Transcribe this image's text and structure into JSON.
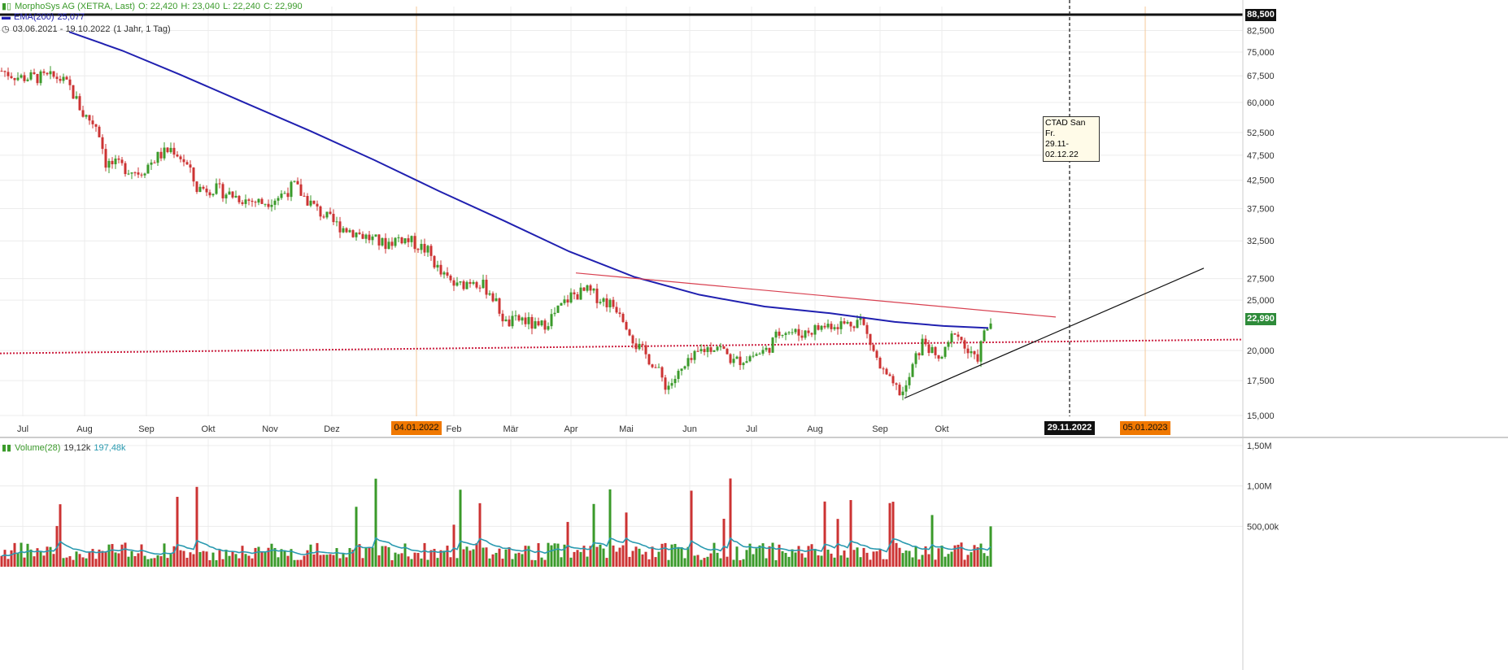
{
  "header": {
    "instrument": "MorphoSys AG (XETRA, Last)",
    "open": "O: 22,420",
    "high": "H: 23,040",
    "low": "L: 22,240",
    "close": "C: 22,990",
    "ema_label": "EMA(200)",
    "ema_value": "25,077",
    "range": "03.06.2021 - 19.10.2022",
    "period": "(1 Jahr, 1 Tag)"
  },
  "volume_header": {
    "label": "Volume(28)",
    "v1": "19,12k",
    "v2": "197,48k"
  },
  "annotation": {
    "line1": "CTAD San Fr.",
    "line2": "29.11-02.12.22"
  },
  "price_tags": {
    "top": "88,500",
    "last": "22,990"
  },
  "date_tags": {
    "d1": "04.01.2022",
    "d2": "29.11.2022",
    "d3": "05.01.2023"
  },
  "colors": {
    "up": "#3a9a2a",
    "down": "#cc3333",
    "ema": "#2020b0",
    "volume_avg": "#2a9ab0",
    "orange": "#f07800",
    "trend_red": "#d84050",
    "dotted_red": "#cc2040"
  },
  "chart_data": {
    "type": "candlestick",
    "scale": "log",
    "y_ticks": [
      "82,500",
      "75,000",
      "67,500",
      "60,000",
      "52,500",
      "47,500",
      "42,500",
      "37,500",
      "32,500",
      "27,500",
      "25,000",
      "20,000",
      "17,500",
      "15,000"
    ],
    "y_tick_values": [
      82.5,
      75,
      67.5,
      60,
      52.5,
      47.5,
      42.5,
      37.5,
      32.5,
      27.5,
      25,
      20,
      17.5,
      15
    ],
    "x_ticks": [
      "Jul",
      "Aug",
      "Sep",
      "Okt",
      "Nov",
      "Dez",
      "Feb",
      "Mär",
      "Apr",
      "Mai",
      "Jun",
      "Jul",
      "Aug",
      "Sep",
      "Okt"
    ],
    "x_tick_days": [
      28,
      104,
      180,
      256,
      332,
      408,
      558,
      628,
      702,
      770,
      848,
      924,
      1002,
      1082,
      1158
    ],
    "volume_ticks": [
      "1,50M",
      "1,00M",
      "500,00k"
    ],
    "volume_tick_values": [
      1.5,
      1.0,
      0.5
    ],
    "price_anchors": [
      [
        0,
        69
      ],
      [
        22,
        67
      ],
      [
        48,
        67
      ],
      [
        70,
        67
      ],
      [
        84,
        64
      ],
      [
        100,
        57
      ],
      [
        118,
        54
      ],
      [
        128,
        46
      ],
      [
        150,
        45
      ],
      [
        170,
        44
      ],
      [
        190,
        47
      ],
      [
        210,
        49
      ],
      [
        226,
        46
      ],
      [
        240,
        41
      ],
      [
        260,
        41
      ],
      [
        280,
        40
      ],
      [
        300,
        39
      ],
      [
        320,
        38.5
      ],
      [
        340,
        39.5
      ],
      [
        360,
        41.5
      ],
      [
        372,
        39.5
      ],
      [
        390,
        37
      ],
      [
        410,
        35
      ],
      [
        430,
        34
      ],
      [
        450,
        33
      ],
      [
        470,
        32
      ],
      [
        490,
        33
      ],
      [
        510,
        32
      ],
      [
        524,
        31
      ],
      [
        540,
        28
      ],
      [
        560,
        26.5
      ],
      [
        580,
        27.5
      ],
      [
        600,
        26
      ],
      [
        620,
        22.5
      ],
      [
        640,
        23
      ],
      [
        660,
        22
      ],
      [
        680,
        23.5
      ],
      [
        700,
        25.5
      ],
      [
        720,
        26
      ],
      [
        740,
        25
      ],
      [
        760,
        24
      ],
      [
        780,
        20.5
      ],
      [
        800,
        19
      ],
      [
        818,
        17
      ],
      [
        840,
        18.5
      ],
      [
        860,
        20
      ],
      [
        880,
        20.5
      ],
      [
        900,
        19
      ],
      [
        920,
        19.5
      ],
      [
        940,
        20
      ],
      [
        960,
        22
      ],
      [
        980,
        21.5
      ],
      [
        1000,
        22
      ],
      [
        1020,
        22.5
      ],
      [
        1040,
        22.5
      ],
      [
        1056,
        23
      ],
      [
        1066,
        21
      ],
      [
        1080,
        18.5
      ],
      [
        1096,
        17
      ],
      [
        1110,
        16.5
      ],
      [
        1122,
        19
      ],
      [
        1134,
        21
      ],
      [
        1150,
        19
      ],
      [
        1162,
        20
      ],
      [
        1172,
        22
      ],
      [
        1186,
        20
      ],
      [
        1198,
        19
      ],
      [
        1208,
        21.5
      ],
      [
        1218,
        23
      ]
    ],
    "ema_anchors": [
      [
        85,
        82
      ],
      [
        150,
        75.5
      ],
      [
        220,
        68
      ],
      [
        300,
        60
      ],
      [
        380,
        53
      ],
      [
        460,
        46.5
      ],
      [
        540,
        40.5
      ],
      [
        620,
        35.5
      ],
      [
        700,
        31
      ],
      [
        780,
        27.7
      ],
      [
        860,
        25.6
      ],
      [
        940,
        24.3
      ],
      [
        1020,
        23.6
      ],
      [
        1100,
        22.7
      ],
      [
        1160,
        22.3
      ],
      [
        1215,
        22.1
      ]
    ],
    "resistance_line": {
      "from": [
        708,
        28.2
      ],
      "to": [
        1298,
        23.2
      ]
    },
    "support_line": {
      "from": [
        1112,
        16.2
      ],
      "to": [
        1480,
        28.8
      ]
    },
    "dotted_level": {
      "from_value": 19.75,
      "to_value": 21.0
    },
    "vertical_marker_day": 1315
  }
}
